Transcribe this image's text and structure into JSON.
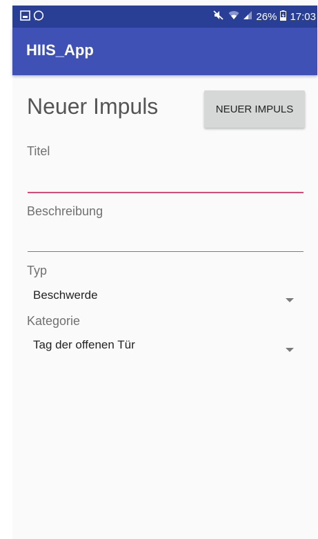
{
  "status_bar": {
    "battery": "26%",
    "time": "17:03",
    "left_icons": [
      "gallery-icon",
      "whatsapp-icon"
    ],
    "right_icons": [
      "mute-icon",
      "wifi-icon",
      "signal-icon",
      "battery-icon"
    ]
  },
  "app_bar": {
    "title": "HIIS_App"
  },
  "form": {
    "title": "Neuer Impuls",
    "submit_label": "NEUER IMPULS",
    "titel_label": "Titel",
    "titel_value": "",
    "beschreibung_label": "Beschreibung",
    "beschreibung_value": "",
    "typ_label": "Typ",
    "typ_selected": "Beschwerde",
    "kategorie_label": "Kategorie",
    "kategorie_selected": "Tag der offenen Tür"
  },
  "colors": {
    "status_bar": "#293f96",
    "app_bar": "#3f51b5",
    "accent": "#e8427b",
    "button": "#d6d7d7",
    "background": "#fafafa"
  }
}
